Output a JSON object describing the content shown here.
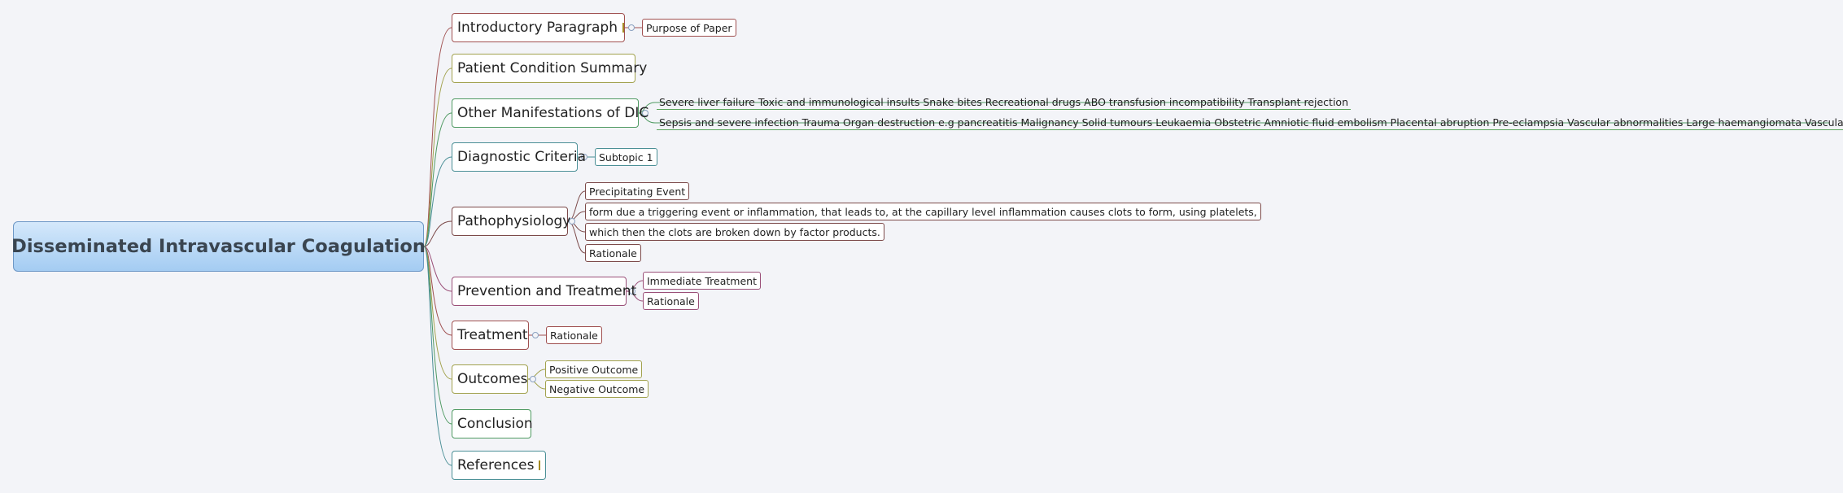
{
  "central": "Disseminated Intravascular Coagulation",
  "topics": {
    "introductory_paragraph": {
      "label": "Introductory Paragraph",
      "note_icon": "note-icon",
      "sub": [
        "Purpose of Paper"
      ]
    },
    "patient_condition_summary": {
      "label": "Patient Condition Summary"
    },
    "other_manifestations": {
      "label": "Other Manifestations of DIC",
      "sub": [
        "Severe liver failure Toxic and immunological insults Snake bites Recreational drugs ABO transfusion incompatibility Transplant rejection",
        "Sepsis and severe infection Trauma Organ destruction e.g pancreatitis Malignancy Solid tumours Leukaemia Obstetric Amniotic fluid embolism Placental abruption Pre-eclampsia Vascular abnormalities Large haemangiomata Vascular aneurysm"
      ]
    },
    "diagnostic_criteria": {
      "label": "Diagnostic Criteria",
      "sub": [
        "Subtopic 1"
      ]
    },
    "pathophysiology": {
      "label": "Pathophysiology",
      "sub": [
        "Precipitating Event",
        "form due a triggering event or inflammation, that leads to,  at the capillary level inflammation causes clots to form, using platelets,",
        "which then the clots are broken down by factor products.",
        "Rationale"
      ]
    },
    "prevention_treatment": {
      "label": "Prevention and Treatment",
      "sub": [
        "Immediate Treatment",
        "Rationale"
      ]
    },
    "treatment": {
      "label": "Treatment",
      "sub": [
        "Rationale"
      ]
    },
    "outcomes": {
      "label": "Outcomes",
      "sub": [
        "Positive Outcome",
        "Negative Outcome"
      ]
    },
    "conclusion": {
      "label": "Conclusion"
    },
    "references": {
      "label": "References",
      "note_icon": "note-icon"
    }
  },
  "colors": {
    "background": "#f3f4f8",
    "central_top": "#d4e8fb",
    "central_bottom": "#a4ccf2",
    "branch_red": "#a05050",
    "branch_olive": "#a2a24e",
    "branch_green": "#4f9a62",
    "branch_teal": "#4a8f96",
    "branch_brown": "#7c4a4a",
    "branch_purple": "#9a4f78"
  }
}
